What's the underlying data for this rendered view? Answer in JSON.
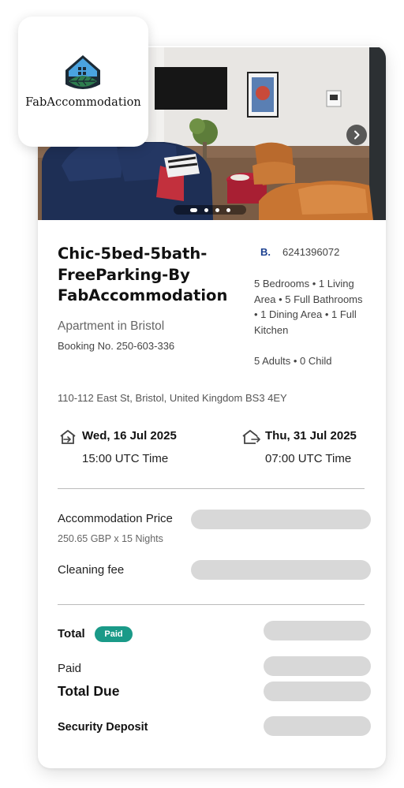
{
  "brand": {
    "name": "FabAccommodation"
  },
  "listing": {
    "title": "Chic-5bed-5bath-FreeParking-By FabAccommodation",
    "property_type": "Apartment in Bristol",
    "booking_number": "Booking No. 250-603-336",
    "channel_logo": "B.",
    "channel_code": "6241396072",
    "rooms": "5 Bedrooms • 1 Living Area • 5 Full Bathrooms • 1 Dining Area • 1 Full Kitchen",
    "guests": "5 Adults • 0 Child",
    "address": "110-112 East St, Bristol, United Kingdom BS3 4EY"
  },
  "gallery": {
    "slide_count": 4,
    "active_slide": 1
  },
  "stay": {
    "checkin_date": "Wed, 16 Jul 2025",
    "checkin_time": "15:00 UTC Time",
    "checkout_date": "Thu, 31 Jul 2025",
    "checkout_time": "07:00 UTC Time"
  },
  "pricing": {
    "accommodation_label": "Accommodation Price",
    "accommodation_detail": "250.65 GBP x 15 Nights",
    "cleaning_label": "Cleaning fee",
    "total_label": "Total",
    "paid_badge": "Paid",
    "paid_label": "Paid",
    "total_due_label": "Total Due",
    "deposit_label": "Security Deposit"
  },
  "colors": {
    "paid_badge": "#1a9a88",
    "placeholder": "#d8d8d8",
    "logo_blue": "#4aa3df",
    "logo_green": "#2e7d4f"
  }
}
